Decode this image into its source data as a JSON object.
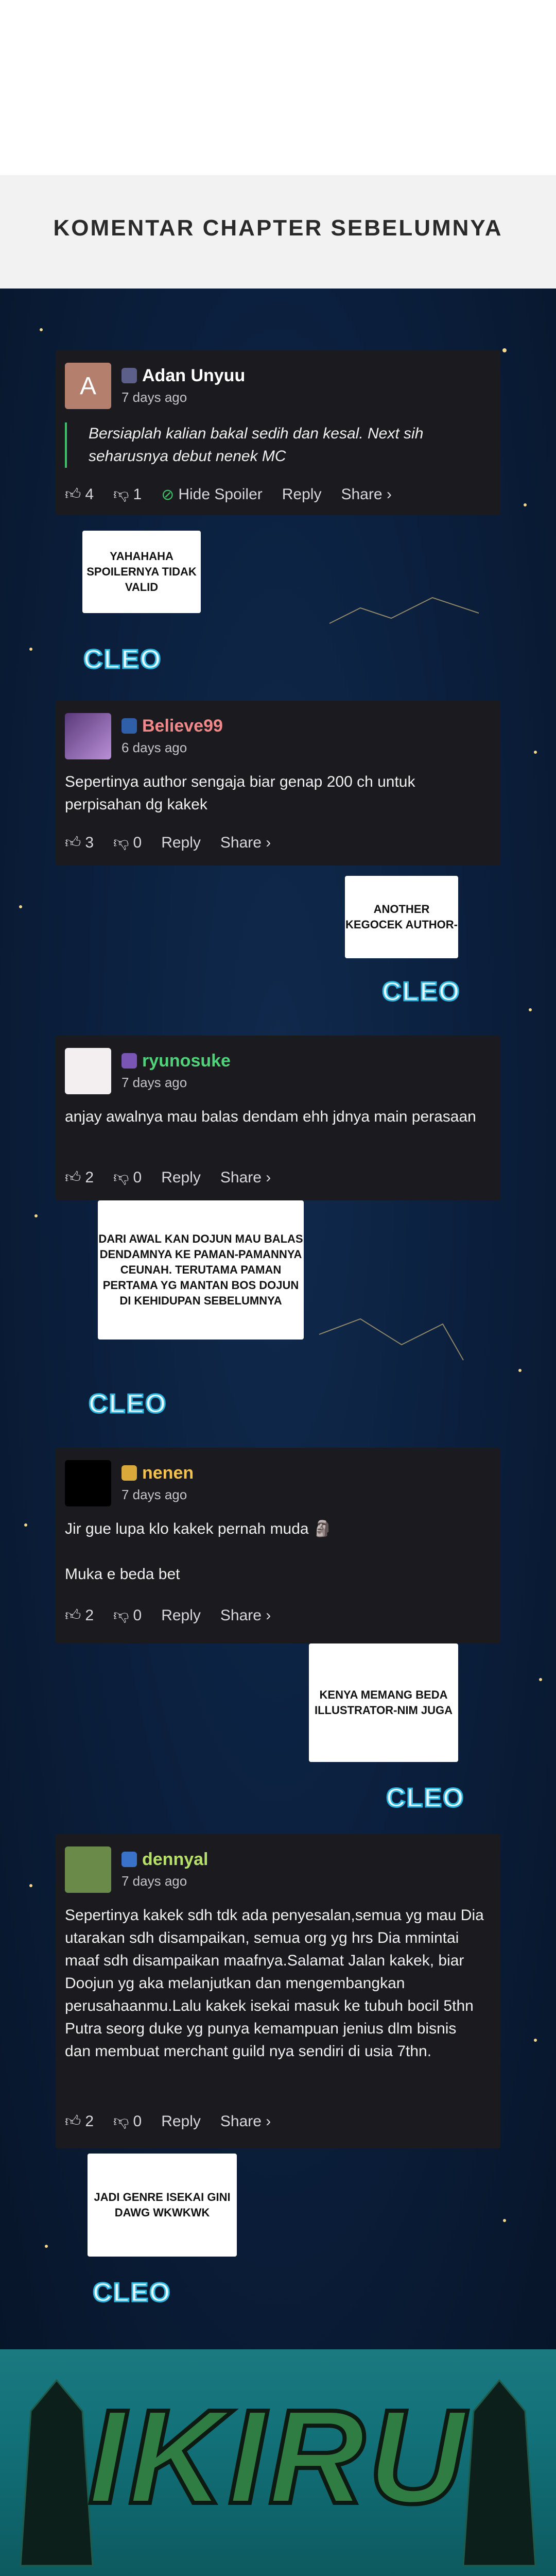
{
  "header": {
    "title": "KOMENTAR CHAPTER SEBELUMNYA"
  },
  "comments": [
    {
      "username": "Adan Unyuu",
      "time": "7 days ago",
      "avatar_letter": "A",
      "text": "Bersiaplah kalian bakal sedih dan kesal. Next sih seharusnya debut nenek MC",
      "likes": "4",
      "dislikes": "1",
      "hide_label": "Hide Spoiler",
      "reply_label": "Reply",
      "share_label": "Share ›",
      "name_color": "#ffffff"
    },
    {
      "username": "Believe99",
      "time": "6 days ago",
      "text": "Sepertinya author sengaja biar genap 200 ch untuk perpisahan dg kakek",
      "likes": "3",
      "dislikes": "0",
      "reply_label": "Reply",
      "share_label": "Share ›",
      "name_color": "#f08a8a"
    },
    {
      "username": "ryunosuke",
      "time": "7 days ago",
      "text": "anjay awalnya mau balas dendam ehh jdnya main perasaan",
      "likes": "2",
      "dislikes": "0",
      "reply_label": "Reply",
      "share_label": "Share ›",
      "name_color": "#4fd27a"
    },
    {
      "username": "nenen",
      "time": "7 days ago",
      "text_line1": "Jir gue lupa klo kakek pernah muda 🗿",
      "text_line2": "Muka e beda bet",
      "likes": "2",
      "dislikes": "0",
      "reply_label": "Reply",
      "share_label": "Share ›",
      "name_color": "#f2c14e"
    },
    {
      "username": "dennyal",
      "time": "7 days ago",
      "text": "Sepertinya kakek sdh tdk ada penyesalan,semua yg mau Dia utarakan sdh disampaikan, semua org yg hrs Dia mmintai maaf sdh disampaikan maafnya.Salamat Jalan kakek, biar Doojun yg aka melanjutkan dan mengembangkan perusahaanmu.Lalu kakek isekai masuk ke tubuh bocil 5thn Putra seorg duke yg punya kemampuan jenius dlm bisnis dan membuat merchant guild nya sendiri di usia 7thn.",
      "likes": "2",
      "dislikes": "0",
      "reply_label": "Reply",
      "share_label": "Share ›",
      "name_color": "#b6e06a"
    }
  ],
  "bubbles": [
    "YAHAHAHA SPOILERNYA TIDAK VALID",
    "ANOTHER KEGOCEK AUTHOR-",
    "DARI AWAL KAN DOJUN MAU BALAS DENDAMNYA KE PAMAN-PAMANNYA CEUNAH. TERUTAMA PAMAN PERTAMA YG MANTAN BOS DOJUN DI KEHIDUPAN SEBELUMNYA",
    "KENYA MEMANG BEDA ILLUSTRATOR-NIM JUGA",
    "JADI GENRE ISEKAI GINI DAWG WKWKWK"
  ],
  "signature": "CLEO",
  "footer": {
    "logo": "IKIRU"
  }
}
